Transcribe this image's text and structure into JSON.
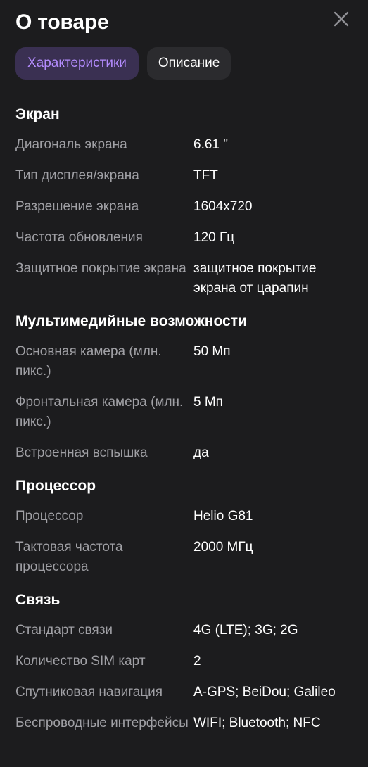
{
  "header": {
    "title": "О товаре"
  },
  "tabs": [
    {
      "label": "Характеристики",
      "active": true
    },
    {
      "label": "Описание",
      "active": false
    }
  ],
  "colors": {
    "background": "#1c1c1e",
    "accent": "#b48cff",
    "active_tab_bg": "#3a3052",
    "muted_text": "#a0a0a5"
  },
  "sections": [
    {
      "title": "Экран",
      "rows": [
        {
          "key": "Диагональ экрана",
          "value": "6.61 \""
        },
        {
          "key": "Тип дисплея/экрана",
          "value": "TFT"
        },
        {
          "key": "Разрешение экрана",
          "value": "1604x720"
        },
        {
          "key": "Частота обновления",
          "value": "120 Гц"
        },
        {
          "key": "Защитное покрытие экрана",
          "value": "защитное покрытие экрана от царапин"
        }
      ]
    },
    {
      "title": "Мультимедийные возможности",
      "rows": [
        {
          "key": "Основная камера (млн. пикс.)",
          "value": "50 Мп"
        },
        {
          "key": "Фронтальная камера (млн. пикс.)",
          "value": "5 Мп"
        },
        {
          "key": "Встроенная вспышка",
          "value": "да"
        }
      ]
    },
    {
      "title": "Процессор",
      "rows": [
        {
          "key": "Процессор",
          "value": "Helio G81"
        },
        {
          "key": "Тактовая частота процессора",
          "value": "2000 МГц"
        }
      ]
    },
    {
      "title": "Связь",
      "rows": [
        {
          "key": "Стандарт связи",
          "value": "4G (LTE); 3G; 2G"
        },
        {
          "key": "Количество SIM карт",
          "value": "2"
        },
        {
          "key": "Спутниковая навигация",
          "value": "A-GPS; BeiDou; Galileo"
        },
        {
          "key": "Беспроводные интерфейсы",
          "value": "WIFI; Bluetooth; NFC"
        }
      ]
    }
  ]
}
